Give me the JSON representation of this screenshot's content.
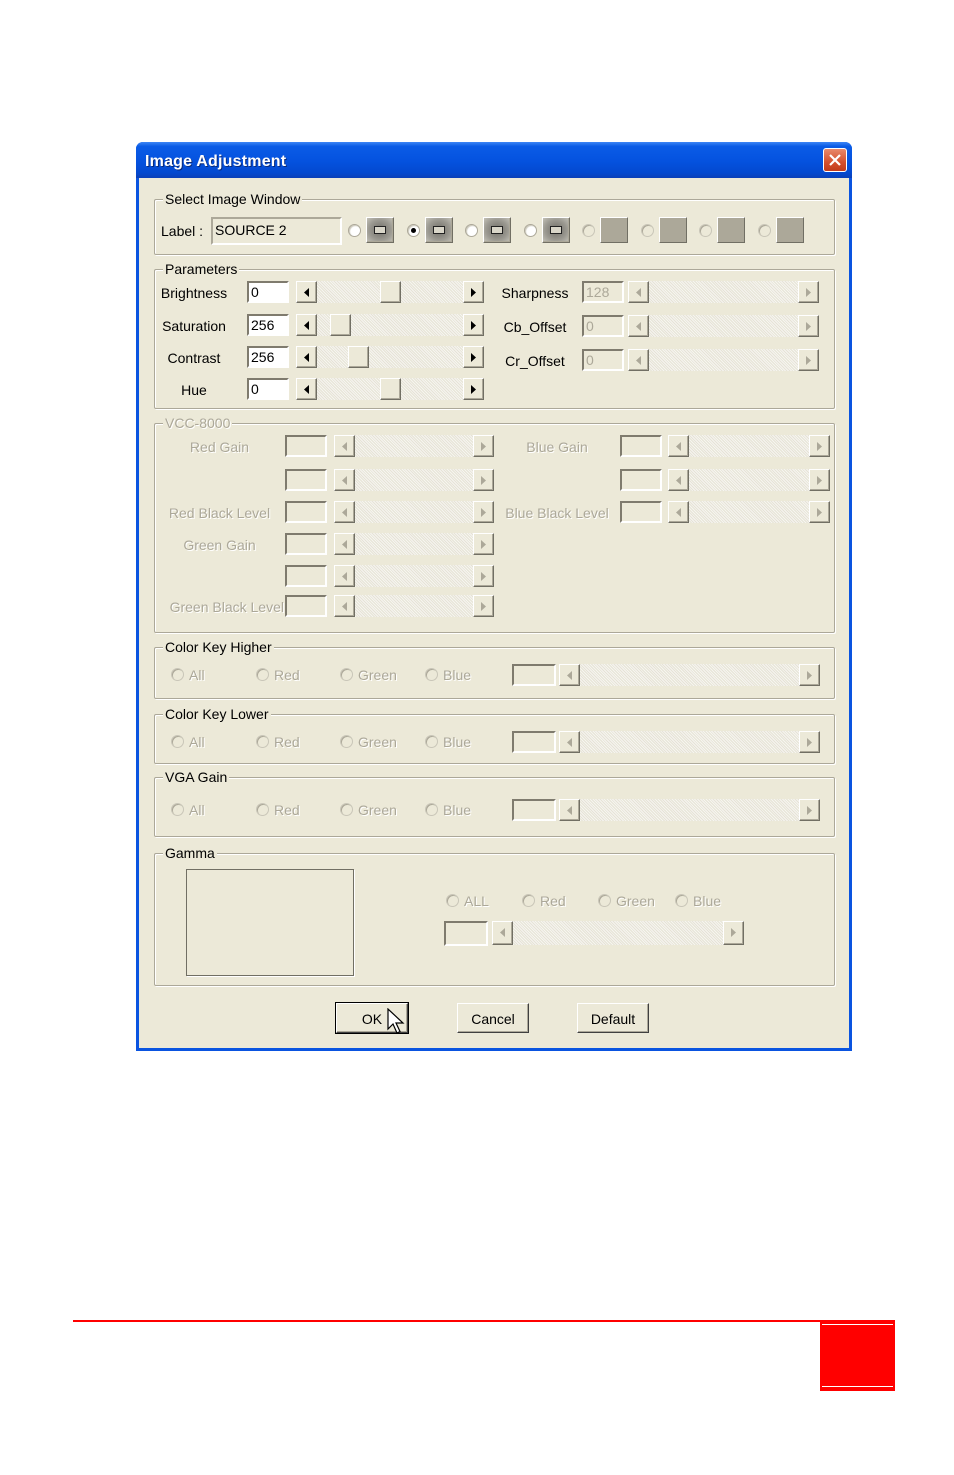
{
  "dialog": {
    "title": "Image Adjustment",
    "close_icon": "close-icon"
  },
  "select_image_window": {
    "group_title": "Select Image Window",
    "label_caption": "Label :",
    "label_value": "SOURCE 2",
    "windows": [
      {
        "selected": false,
        "enabled": true
      },
      {
        "selected": true,
        "enabled": true
      },
      {
        "selected": false,
        "enabled": true
      },
      {
        "selected": false,
        "enabled": true
      },
      {
        "selected": false,
        "enabled": false
      },
      {
        "selected": false,
        "enabled": false
      },
      {
        "selected": false,
        "enabled": false
      },
      {
        "selected": false,
        "enabled": false
      }
    ]
  },
  "parameters": {
    "group_title": "Parameters",
    "left": [
      {
        "label": "Brightness",
        "value": "0",
        "slider_fraction": 0.5
      },
      {
        "label": "Saturation",
        "value": "256",
        "slider_fraction": 0.1
      },
      {
        "label": "Contrast",
        "value": "256",
        "slider_fraction": 0.25
      },
      {
        "label": "Hue",
        "value": "0",
        "slider_fraction": 0.5
      }
    ],
    "right": [
      {
        "label": "Sharpness",
        "value": "128"
      },
      {
        "label": "Cb_Offset",
        "value": "0"
      },
      {
        "label": "Cr_Offset",
        "value": "0"
      }
    ]
  },
  "vcc": {
    "group_title": "VCC-8000",
    "left": [
      {
        "label": "Red Gain"
      },
      {
        "label": ""
      },
      {
        "label": "Red Black Level"
      },
      {
        "label": "Green Gain"
      },
      {
        "label": ""
      },
      {
        "label": "Green Black Level"
      }
    ],
    "right": [
      {
        "label": "Blue Gain"
      },
      {
        "label": ""
      },
      {
        "label": "Blue Black Level"
      }
    ]
  },
  "color_key_higher": {
    "group_title": "Color Key Higher",
    "options": [
      "All",
      "Red",
      "Green",
      "Blue"
    ]
  },
  "color_key_lower": {
    "group_title": "Color Key Lower",
    "options": [
      "All",
      "Red",
      "Green",
      "Blue"
    ]
  },
  "vga_gain": {
    "group_title": "VGA Gain",
    "options": [
      "All",
      "Red",
      "Green",
      "Blue"
    ]
  },
  "gamma": {
    "group_title": "Gamma",
    "options": [
      "ALL",
      "Red",
      "Green",
      "Blue"
    ]
  },
  "buttons": {
    "ok": "OK",
    "cancel": "Cancel",
    "default": "Default"
  },
  "colors": {
    "titlebar": "#0553e0",
    "dialog_bg": "#ece9d8",
    "footer_accent": "#ff0000"
  }
}
